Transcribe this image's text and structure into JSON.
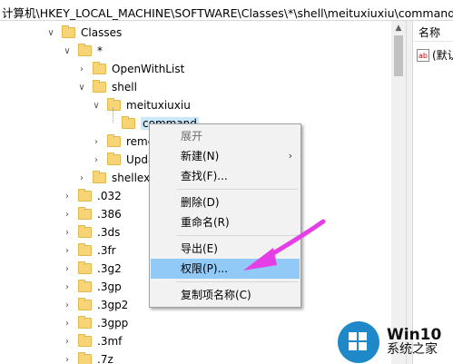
{
  "address_bar": "计算机\\HKEY_LOCAL_MACHINE\\SOFTWARE\\Classes\\*\\shell\\meituxiuxiu\\command",
  "tree": [
    {
      "label": "Classes",
      "expanded": true
    },
    {
      "label": "*",
      "expanded": true
    },
    {
      "label": "OpenWithList",
      "expanded": false
    },
    {
      "label": "shell",
      "expanded": true
    },
    {
      "label": "meituxiuxiu",
      "expanded": true
    },
    {
      "label": "command",
      "selected": true
    },
    {
      "label": "remc",
      "expanded": false
    },
    {
      "label": "Upda",
      "expanded": false
    },
    {
      "label": "shellex",
      "expanded": false
    },
    {
      "label": ".032"
    },
    {
      "label": ".386"
    },
    {
      "label": ".3ds"
    },
    {
      "label": ".3fr"
    },
    {
      "label": ".3g2"
    },
    {
      "label": ".3gp"
    },
    {
      "label": ".3gp2"
    },
    {
      "label": ".3gpp"
    },
    {
      "label": ".3mf"
    },
    {
      "label": ".7z"
    }
  ],
  "right_panel": {
    "column_header": "名称",
    "value_name": "(默认"
  },
  "context_menu": [
    {
      "label": "展开",
      "state": "disabled"
    },
    {
      "label": "新建(N)",
      "submenu": true
    },
    {
      "label": "查找(F)..."
    },
    {
      "label": "删除(D)"
    },
    {
      "label": "重命名(R)"
    },
    {
      "label": "导出(E)"
    },
    {
      "label": "权限(P)...",
      "state": "highlighted"
    },
    {
      "label": "复制项名称(C)"
    }
  ],
  "watermark": {
    "line1": "Win10",
    "line2": "系统之家"
  },
  "colors": {
    "highlight": "#91c9f7",
    "arrow": "#e63ee6",
    "selection": "#cce8ff",
    "folder": "#f6d477"
  },
  "icons": {
    "expand": "chevron-right-icon",
    "collapse": "chevron-down-icon",
    "folder": "folder-icon"
  }
}
